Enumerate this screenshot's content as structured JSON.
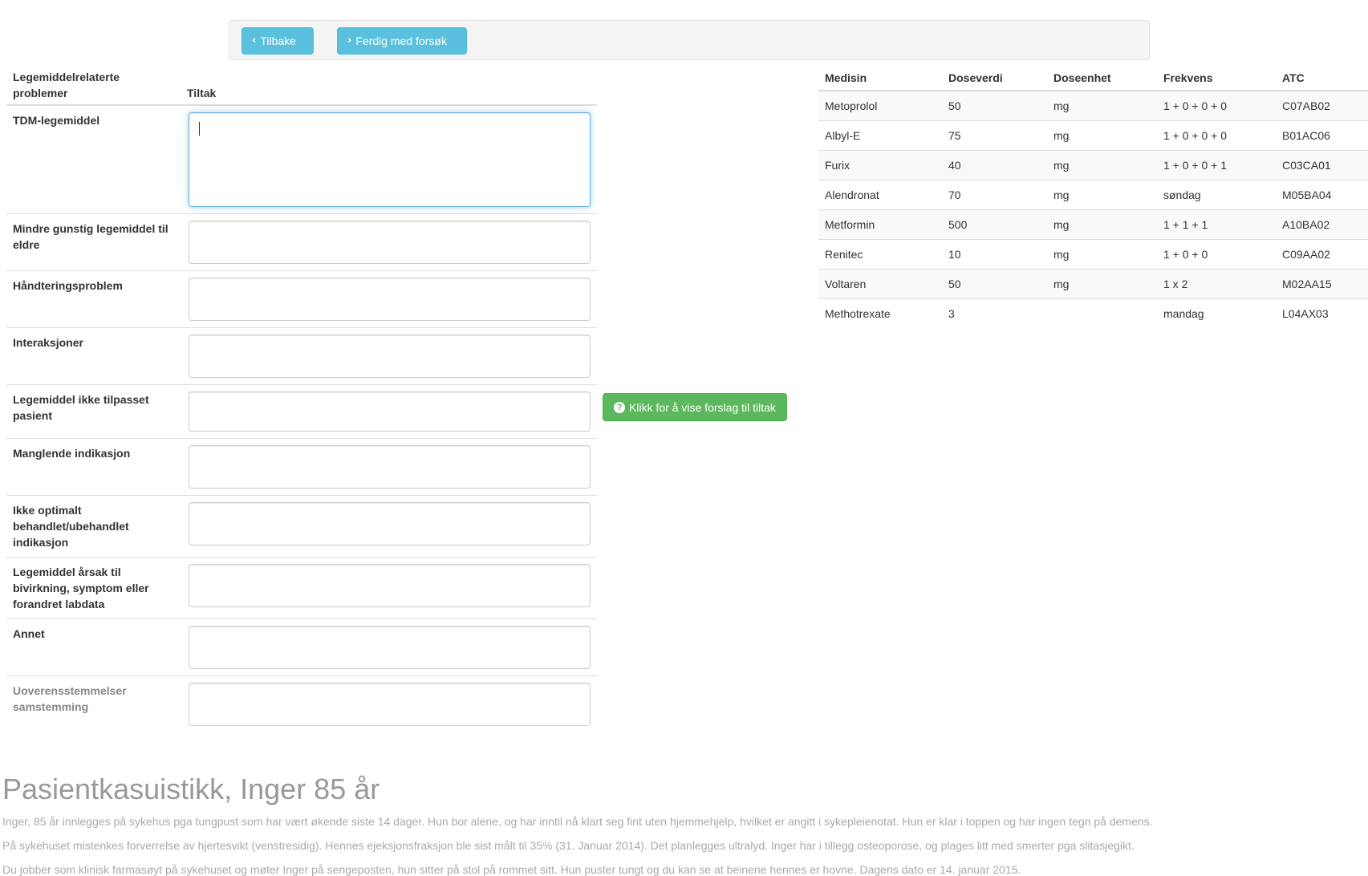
{
  "toolbar": {
    "back_label": "Tilbake",
    "done_label": "Ferdig med forsøk"
  },
  "problems": {
    "header_problem": "Legemiddelrelaterte problemer",
    "header_action": "Tiltak",
    "rows": [
      {
        "label": "TDM-legemiddel",
        "value": ""
      },
      {
        "label": "Mindre gunstig legemiddel til eldre",
        "value": ""
      },
      {
        "label": "Håndteringsproblem",
        "value": ""
      },
      {
        "label": "Interaksjoner",
        "value": ""
      },
      {
        "label": "Legemiddel ikke tilpasset pasient",
        "value": ""
      },
      {
        "label": "Manglende indikasjon",
        "value": ""
      },
      {
        "label": "Ikke optimalt behandlet/ubehandlet indikasjon",
        "value": ""
      },
      {
        "label": "Legemiddel årsak til bivirkning, symptom eller forandret labdata",
        "value": ""
      },
      {
        "label": "Annet",
        "value": ""
      },
      {
        "label": "Uoverensstemmelser samstemming",
        "value": ""
      }
    ]
  },
  "suggest_button": {
    "label": "Klikk for å vise forslag til tiltak",
    "icon": "question-circle-icon"
  },
  "medications": {
    "headers": [
      "Medisin",
      "Doseverdi",
      "Doseenhet",
      "Frekvens",
      "ATC"
    ],
    "rows": [
      [
        "Metoprolol",
        "50",
        "mg",
        "1 + 0 + 0 + 0",
        "C07AB02"
      ],
      [
        "Albyl-E",
        "75",
        "mg",
        "1 + 0 + 0 + 0",
        "B01AC06"
      ],
      [
        "Furix",
        "40",
        "mg",
        "1 + 0 + 0 + 1",
        "C03CA01"
      ],
      [
        "Alendronat",
        "70",
        "mg",
        "søndag",
        "M05BA04"
      ],
      [
        "Metformin",
        "500",
        "mg",
        "1 + 1 + 1",
        "A10BA02"
      ],
      [
        "Renitec",
        "10",
        "mg",
        "1 + 0 + 0",
        "C09AA02"
      ],
      [
        "Voltaren",
        "50",
        "mg",
        "1 x 2",
        "M02AA15"
      ],
      [
        "Methotrexate",
        "3",
        "",
        "mandag",
        "L04AX03"
      ]
    ]
  },
  "case": {
    "title": "Pasientkasuistikk, Inger 85 år",
    "paragraphs": [
      "Inger, 85 år innlegges på sykehus pga tungpust som har vært økende siste 14 dager. Hun bor alene, og har inntil nå klart seg fint uten hjemmehjelp, hvilket er angitt i sykepleienotat. Hun er klar i toppen og har ingen tegn på demens.",
      "På sykehuset mistenkes forverrelse av hjertesvikt (venstresidig). Hennes ejeksjonsfraksjon ble sist målt til 35% (31. Januar 2014). Det planlegges ultralyd. Inger har i tillegg osteoporose, og plages litt med smerter pga slitasjegikt.",
      "Du jobber som klinisk farmasøyt på sykehuset og møter Inger på sengeposten, hun sitter på stol på rommet sitt. Hun puster tungt og du kan se at beinene hennes er hovne. Dagens dato er 14. januar 2015."
    ]
  },
  "colors": {
    "info_button": "#5bc0de",
    "success_button": "#5cb85c",
    "focus_border": "#66afe9"
  }
}
